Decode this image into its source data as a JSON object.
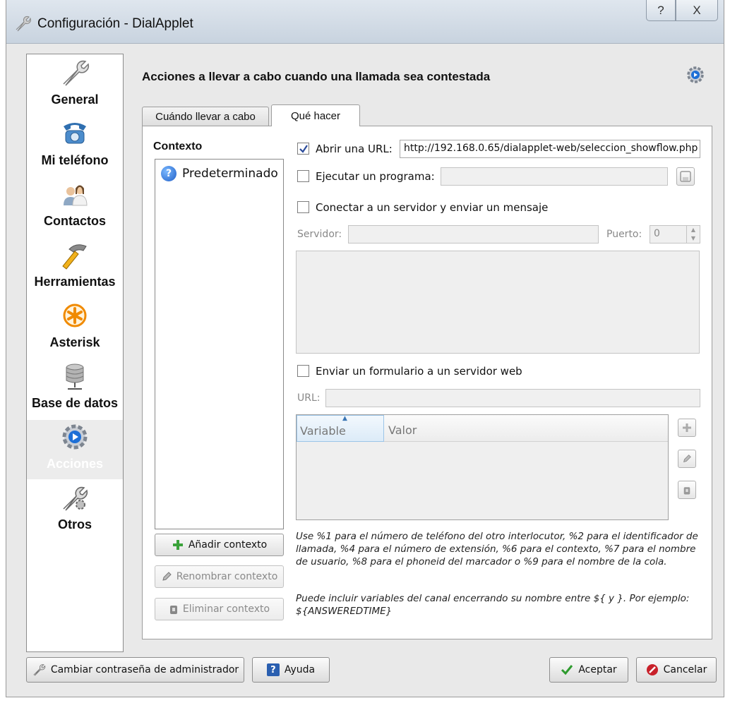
{
  "window": {
    "title": "Configuración - DialApplet",
    "help_glyph": "?",
    "close_glyph": "X"
  },
  "sidebar": {
    "items": [
      {
        "label": "General",
        "icon": "wrench-icon"
      },
      {
        "label": "Mi teléfono",
        "icon": "telephone-icon"
      },
      {
        "label": "Contactos",
        "icon": "contacts-icon"
      },
      {
        "label": "Herramientas",
        "icon": "hammer-icon"
      },
      {
        "label": "Asterisk",
        "icon": "asterisk-icon"
      },
      {
        "label": "Base de datos",
        "icon": "database-icon"
      },
      {
        "label": "Acciones",
        "icon": "gear-icon",
        "active": true
      },
      {
        "label": "Otros",
        "icon": "tools-icon"
      }
    ]
  },
  "header": {
    "title": "Acciones a llevar a cabo cuando una llamada sea contestada"
  },
  "tabs": [
    {
      "label": "Cuándo llevar a cabo"
    },
    {
      "label": "Qué hacer"
    }
  ],
  "context": {
    "title": "Contexto",
    "items": [
      "Predeterminado"
    ],
    "add_label": "Añadir contexto",
    "rename_label": "Renombrar contexto",
    "delete_label": "Eliminar contexto"
  },
  "actions": {
    "open_url_label": "Abrir una URL:",
    "open_url_checked": true,
    "open_url_value": "http://192.168.0.65/dialapplet-web/seleccion_showflow.php",
    "run_program_label": "Ejecutar un programa:",
    "run_program_value": "",
    "connect_label": "Conectar a un servidor y enviar un mensaje",
    "server_label": "Servidor:",
    "port_label": "Puerto:",
    "port_value": "0",
    "send_form_label": "Enviar un formulario a un servidor web",
    "url_label": "URL:"
  },
  "table": {
    "columns": [
      "Variable",
      "Valor"
    ]
  },
  "help": {
    "para1": "Use %1 para el número de teléfono del otro interlocutor, %2 para el identificador de llamada, %4 para el número de extensión, %6 para el contexto, %7 para el nombre de usuario, %8 para el phoneid del marcador o %9 para el nombre de la cola.",
    "para2": "Puede incluir variables del canal encerrando su nombre entre ${ y }. Por ejemplo: ${ANSWEREDTIME}"
  },
  "footer": {
    "change_password_label": "Cambiar contraseña de administrador",
    "help_label": "Ayuda",
    "accept_label": "Aceptar",
    "cancel_label": "Cancelar"
  },
  "colors": {
    "accent_blue": "#1f5fc7",
    "accept_green": "#2e9b2e",
    "cancel_red": "#c8202a"
  }
}
